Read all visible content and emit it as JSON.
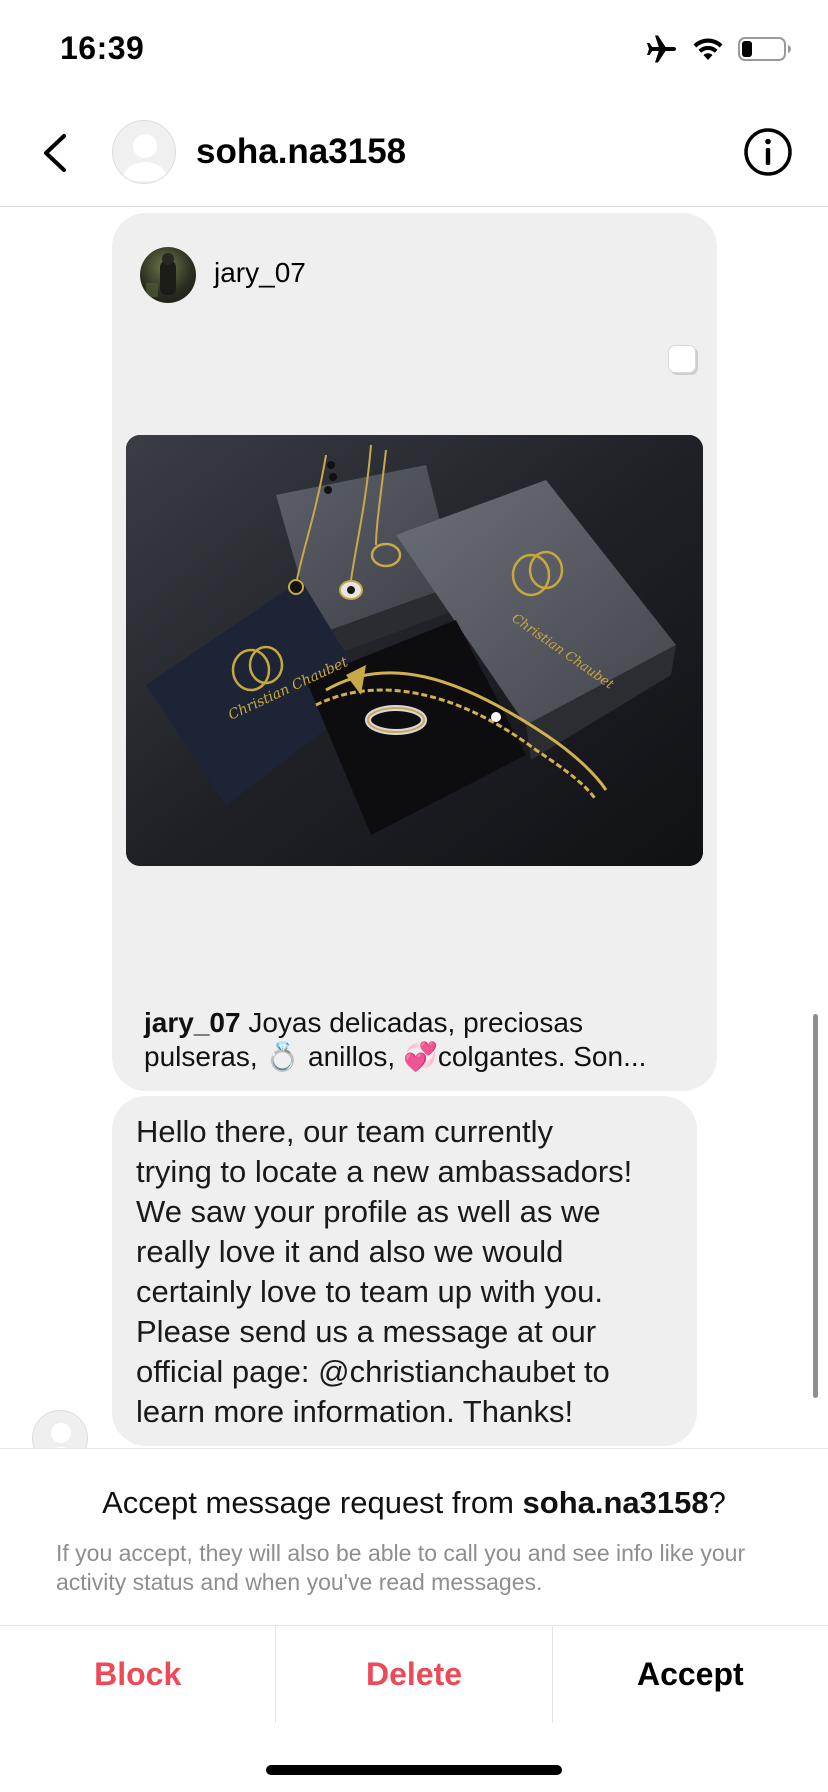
{
  "status_bar": {
    "time": "16:39",
    "icons": [
      "airplane-icon",
      "wifi-icon",
      "battery-icon"
    ]
  },
  "header": {
    "username": "soha.na3158",
    "back_icon": "chevron-left-icon",
    "info_icon": "info-icon"
  },
  "shared_post": {
    "author": "jary_07",
    "caption_author": "jary_07",
    "caption_text": " Joyas delicadas, preciosas pulseras, 💍 anillos, 💞colgantes. Son..."
  },
  "message": {
    "text": "Hello there, our  team  currently\ntrying to  locate a new ambassadors!\nWe saw your profile  as well as we\nreally love it  and also we  would\ncertainly love to  team up with you.\nPlease send us a message at our\nofficial  page:  @christianchaubet to\nlearn more  information. Thanks!"
  },
  "request": {
    "title_prefix": "Accept message request from ",
    "title_user": "soha.na3158",
    "title_suffix": "?",
    "note": "If you accept, they will also be able to call you and see info like your activity status and when you've read messages."
  },
  "actions": {
    "block": "Block",
    "delete": "Delete",
    "accept": "Accept"
  },
  "colors": {
    "danger": "#ed4956",
    "bubble": "#efefef",
    "divider": "#e5e5e5"
  }
}
